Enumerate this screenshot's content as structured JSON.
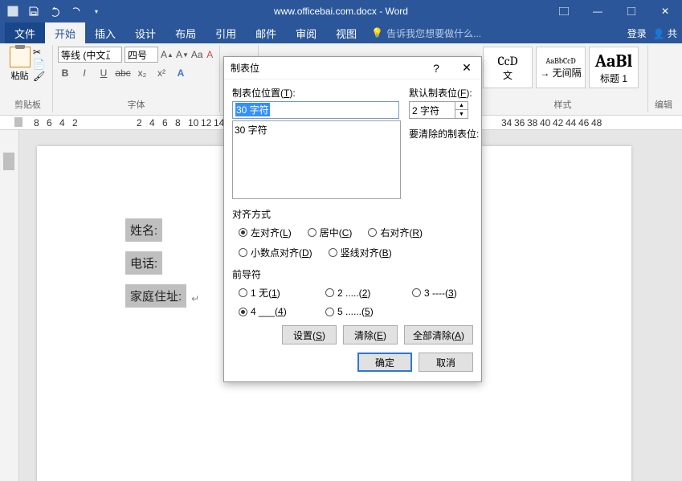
{
  "titlebar": {
    "title": "www.officebai.com.docx - Word",
    "login": "登录",
    "share": "共"
  },
  "menu": {
    "file": "文件",
    "home": "开始",
    "insert": "插入",
    "design": "设计",
    "layout": "布局",
    "references": "引用",
    "mail": "邮件",
    "review": "审阅",
    "view": "视图",
    "tellme": "告诉我您想要做什么..."
  },
  "ribbon": {
    "clipboard": {
      "paste": "粘贴",
      "label": "剪贴板"
    },
    "font": {
      "family": "等线 (中文正",
      "size": "四号",
      "label": "字体"
    },
    "styles": {
      "s1": {
        "preview": "CcD",
        "name": "文"
      },
      "s2": {
        "preview": "AaBbCcD",
        "name": "→ 无间隔"
      },
      "s3": {
        "preview": "AaBl",
        "name": "标题 1"
      },
      "label": "样式"
    },
    "editing": {
      "label": "编辑"
    }
  },
  "ruler": {
    "marks": [
      "8",
      "6",
      "4",
      "2",
      "2",
      "4",
      "6",
      "8",
      "10",
      "12",
      "14",
      "34",
      "36",
      "38",
      "40",
      "42",
      "44",
      "46",
      "48"
    ]
  },
  "doc": {
    "line1": "姓名:",
    "line2": "电话:",
    "line3": "家庭住址:"
  },
  "dialog": {
    "title": "制表位",
    "tabpos_label": "制表位位置(<u>T</u>):",
    "tabpos_value": "30 字符",
    "list_item": "30 字符",
    "default_label": "默认制表位(<u>F</u>):",
    "default_value": "2 字符",
    "clear_label": "要清除的制表位:",
    "align": {
      "title": "对齐方式",
      "left": "左对齐(<u>L</u>)",
      "center": "居中(<u>C</u>)",
      "right": "右对齐(<u>R</u>)",
      "decimal": "小数点对齐(<u>D</u>)",
      "bar": "竖线对齐(<u>B</u>)"
    },
    "leader": {
      "title": "前导符",
      "o1": "1 无(<u>1</u>)",
      "o2": "2 .....(<u>2</u>)",
      "o3": "3 ----(<u>3</u>)",
      "o4": "4 ___(<u>4</u>)",
      "o5": "5 ......(<u>5</u>)"
    },
    "btn": {
      "set": "设置(<u>S</u>)",
      "clear": "清除(<u>E</u>)",
      "clearall": "全部清除(<u>A</u>)",
      "ok": "确定",
      "cancel": "取消"
    }
  }
}
